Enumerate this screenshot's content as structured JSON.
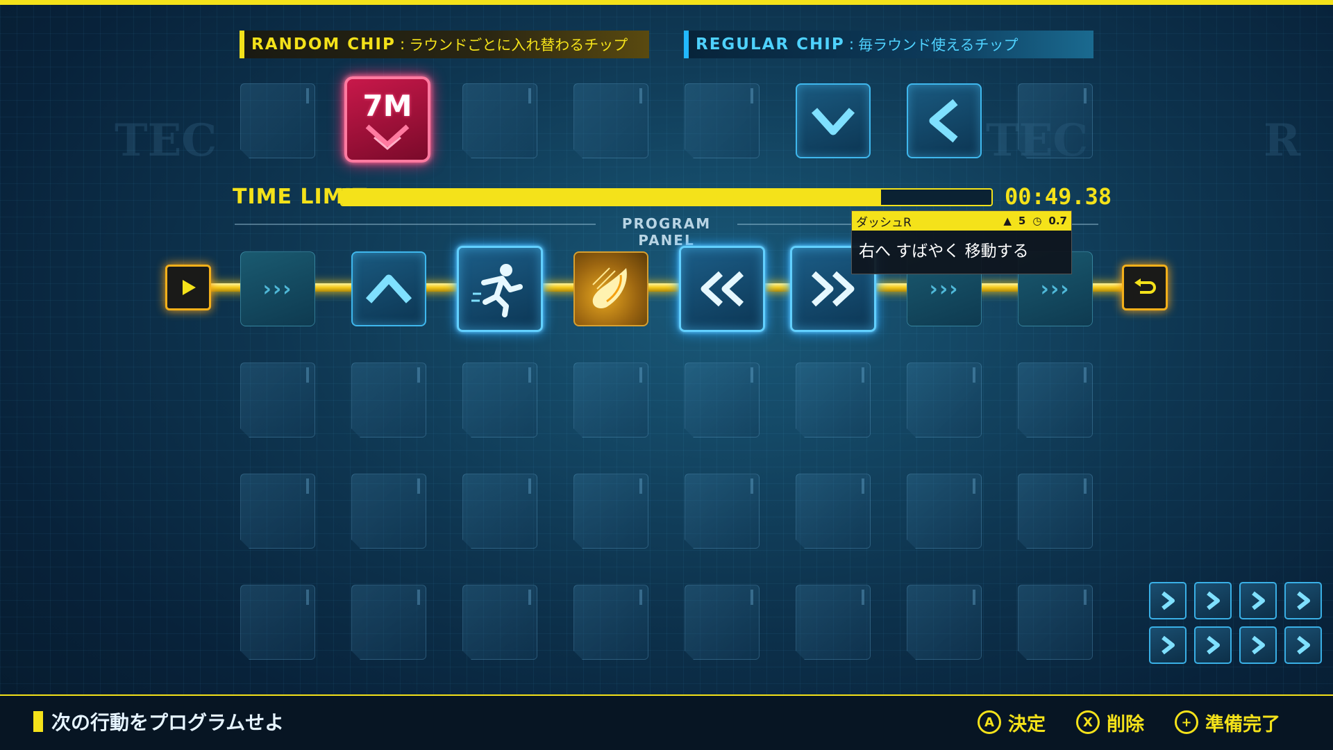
{
  "random_chip": {
    "key": "RANDOM CHIP",
    "desc": "ラウンドごとに入れ替わるチップ",
    "chips": [
      {
        "code": "7M",
        "icon": "down-chevron-icon",
        "color": "#e81a54"
      }
    ]
  },
  "regular_chip": {
    "key": "REGULAR CHIP",
    "desc": "毎ラウンド使えるチップ",
    "chips": [
      {
        "icon": "move-down-icon"
      },
      {
        "icon": "move-left-icon"
      }
    ]
  },
  "time_limit": {
    "label": "TIME LIMIT",
    "value": "00:49.38",
    "remaining_fraction": 0.83
  },
  "program_panel": {
    "label": "PROGRAM PANEL",
    "slots": [
      {
        "state": "empty"
      },
      {
        "icon": "move-up-icon"
      },
      {
        "icon": "dash-runner-icon",
        "selected": true
      },
      {
        "icon": "fire-shot-icon"
      },
      {
        "icon": "dash-left-icon",
        "selected": true
      },
      {
        "icon": "dash-right-icon",
        "selected": true
      },
      {
        "state": "empty"
      },
      {
        "state": "empty"
      }
    ]
  },
  "tooltip": {
    "name": "ダッシュR",
    "cost": "5",
    "time": "0.7",
    "description": "右へ すばやく 移動する"
  },
  "bottom": {
    "message": "次の行動をプログラムせよ",
    "hints": [
      {
        "button": "A",
        "label": "決定"
      },
      {
        "button": "X",
        "label": "削除"
      },
      {
        "button": "+",
        "label": "準備完了"
      }
    ]
  },
  "colors": {
    "accent_yellow": "#f4e21a",
    "accent_blue": "#3fb8ee",
    "random_pink": "#e81a54"
  }
}
